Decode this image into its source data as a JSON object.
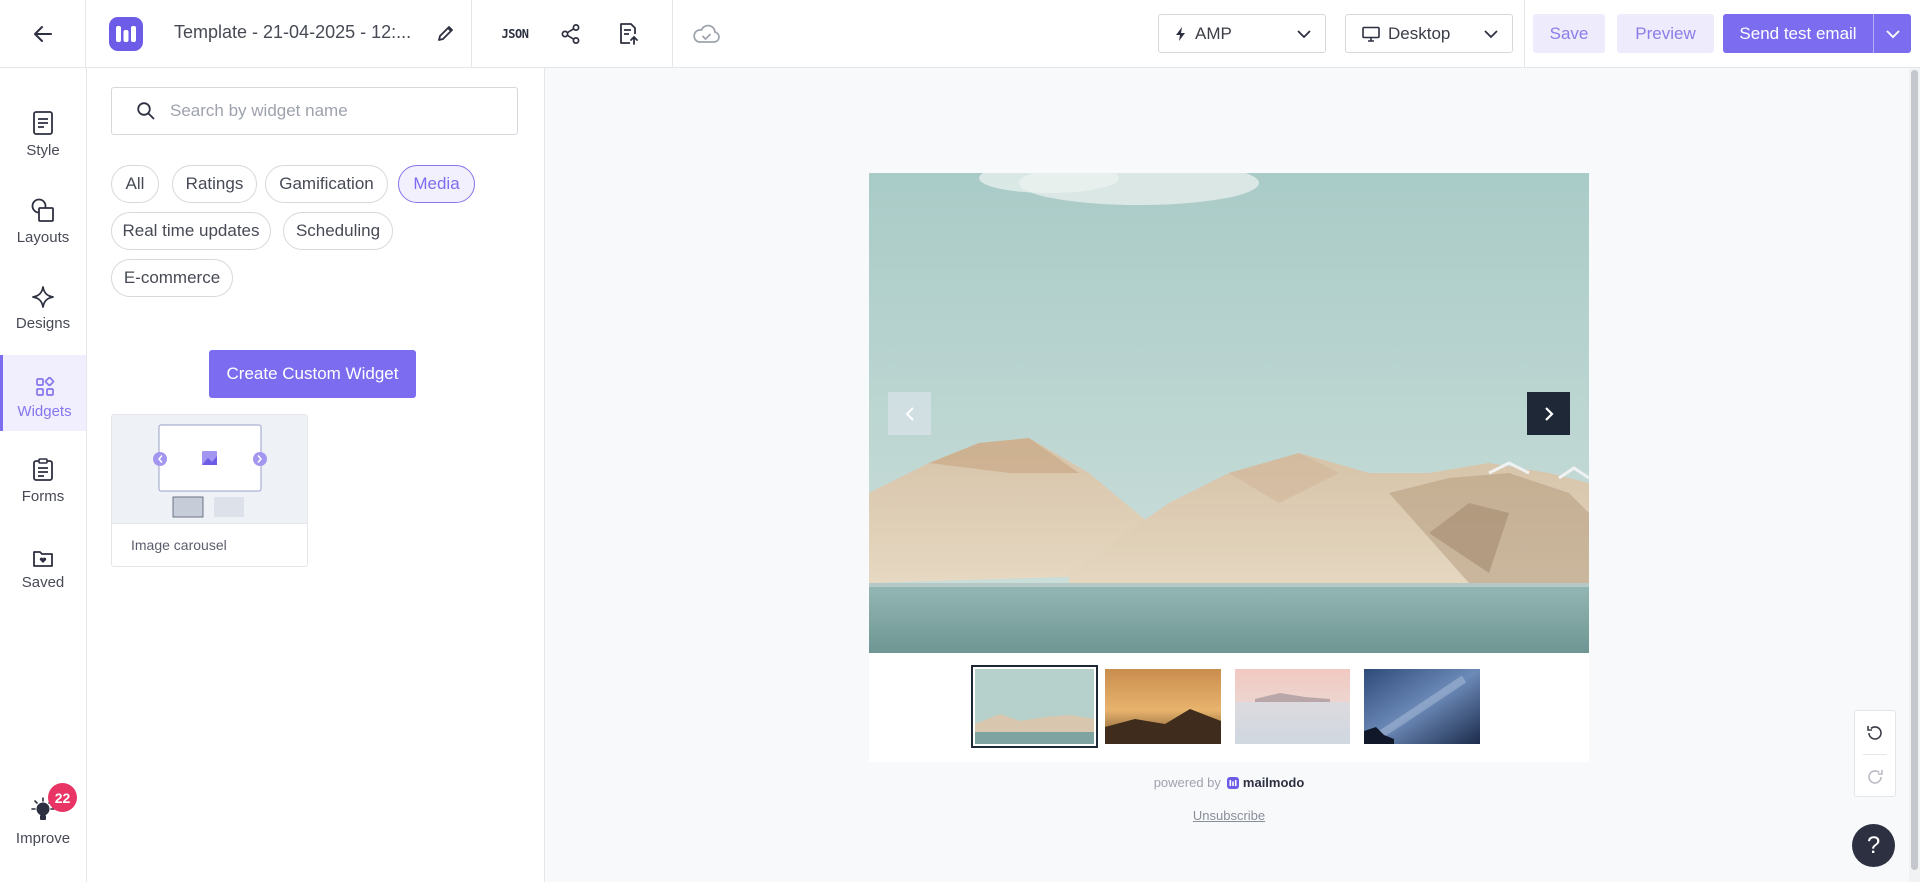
{
  "topbar": {
    "title": "Template - 21-04-2025 - 12:...",
    "json_label": "JSON",
    "format_dropdown": "AMP",
    "device_dropdown": "Desktop",
    "save_label": "Save",
    "preview_label": "Preview",
    "send_label": "Send test email"
  },
  "leftnav": {
    "items": [
      {
        "label": "Style",
        "icon": "style-icon"
      },
      {
        "label": "Layouts",
        "icon": "layouts-icon"
      },
      {
        "label": "Designs",
        "icon": "designs-icon"
      },
      {
        "label": "Widgets",
        "icon": "widgets-icon",
        "active": true
      },
      {
        "label": "Forms",
        "icon": "forms-icon"
      },
      {
        "label": "Saved",
        "icon": "saved-icon"
      }
    ],
    "improve": {
      "label": "Improve",
      "badge": "22"
    }
  },
  "panel": {
    "search_placeholder": "Search by widget name",
    "filters": [
      "All",
      "Ratings",
      "Gamification",
      "Media",
      "Real time updates",
      "Scheduling",
      "E-commerce"
    ],
    "active_filter": "Media",
    "create_label": "Create Custom Widget",
    "widgets": [
      {
        "label": "Image carousel"
      }
    ]
  },
  "canvas": {
    "powered_by": "powered by",
    "brand": "mailmodo",
    "unsubscribe": "Unsubscribe",
    "carousel_selected_index": 0,
    "carousel_count": 4
  },
  "colors": {
    "accent": "#7c6cf0",
    "accent_light": "#eeebfc",
    "badge": "#e93565",
    "dark": "#1f2836"
  }
}
